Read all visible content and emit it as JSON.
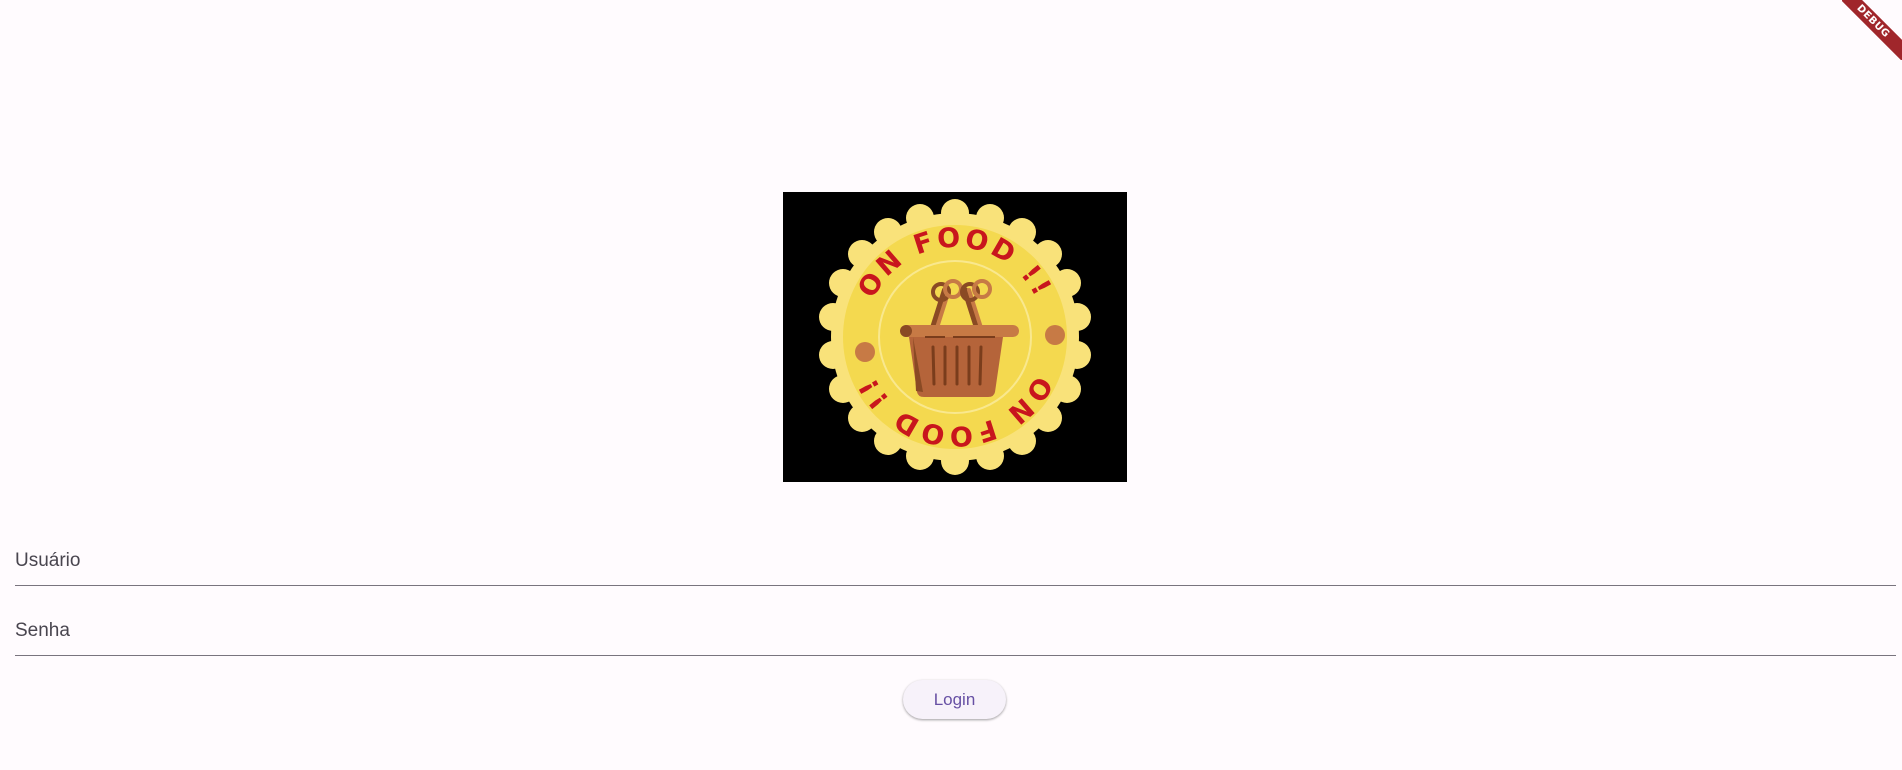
{
  "debug_banner": {
    "label": "DEBUG",
    "color": "#a0262b"
  },
  "logo": {
    "icon": "basket-icon",
    "top_text": "ON FOOD !!",
    "bottom_text": "ON FOOD !!",
    "colors": {
      "background": "#000000",
      "badge_outer": "#f9e27a",
      "badge_inner": "#f4d94f",
      "text": "#c8161d",
      "basket": "#b5643a"
    }
  },
  "form": {
    "user_label": "Usuário",
    "user_value": "",
    "password_label": "Senha",
    "password_value": ""
  },
  "login_button": {
    "label": "Login"
  },
  "theme": {
    "primary": "#6750a4",
    "background": "#fffbfe",
    "underline": "#79747e"
  }
}
